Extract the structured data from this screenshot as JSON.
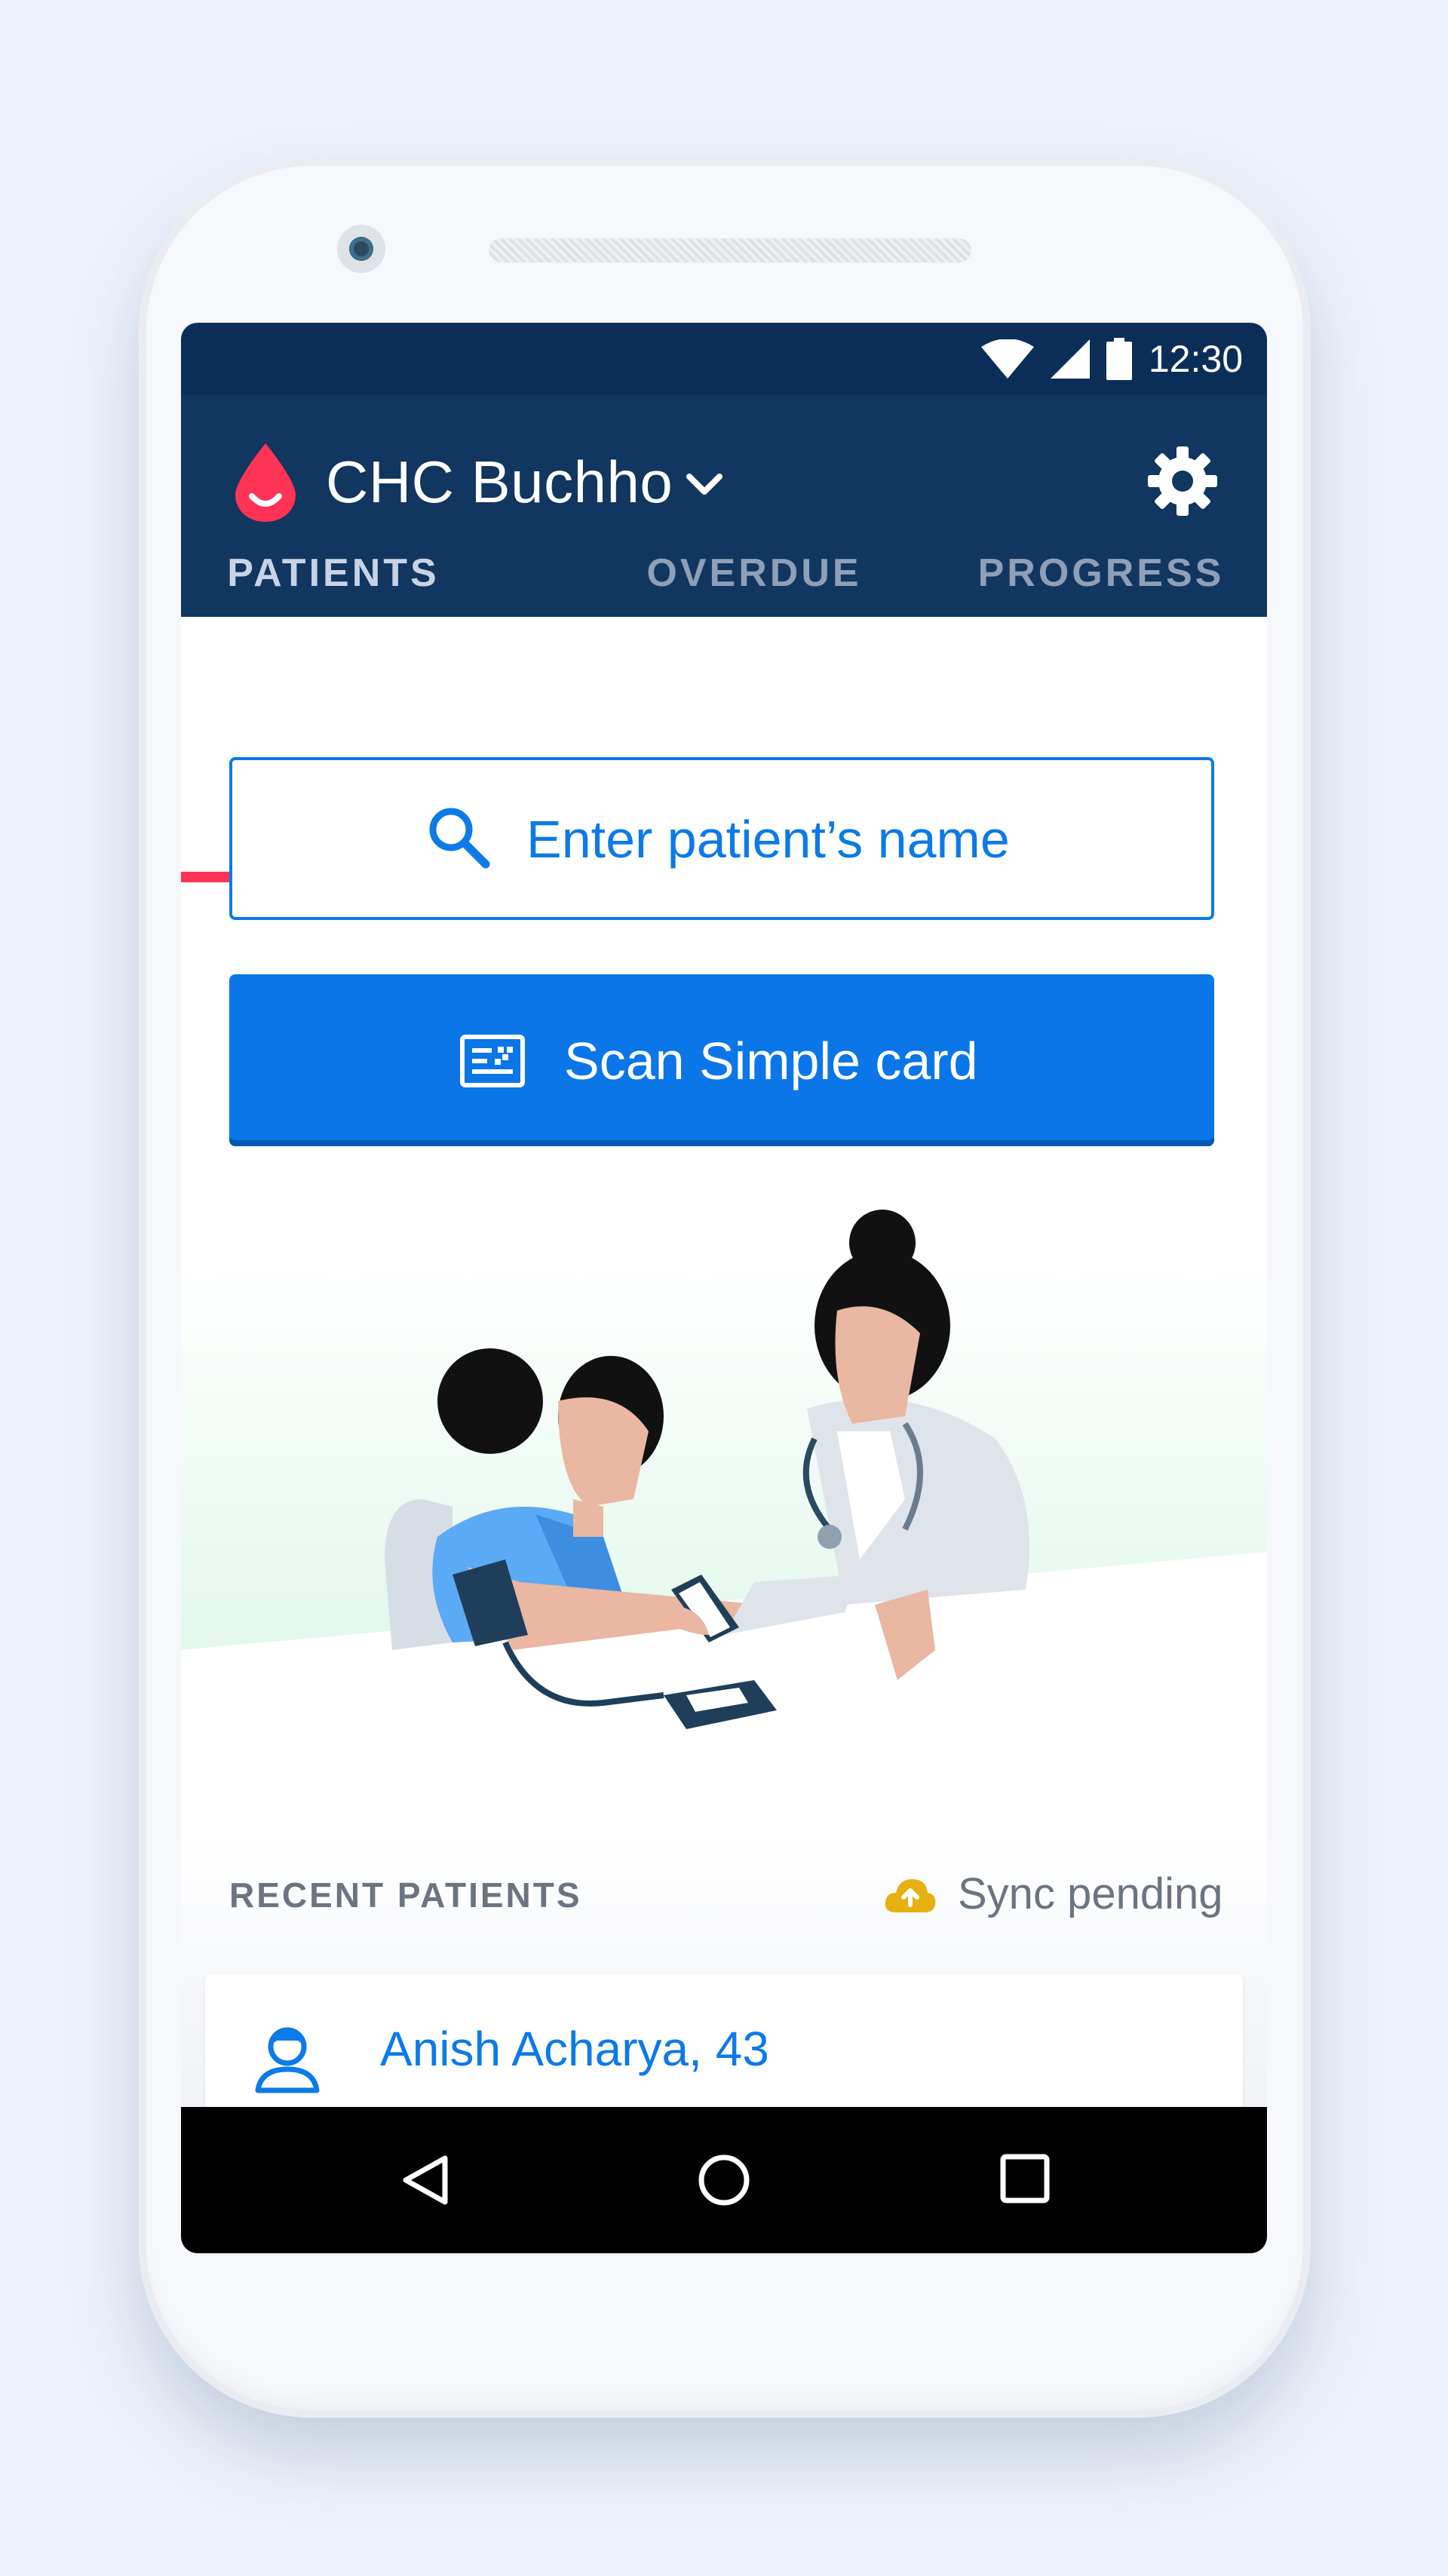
{
  "status_bar": {
    "time": "12:30"
  },
  "app_bar": {
    "facility_name": "CHC Buchho",
    "tabs": [
      {
        "label": "PATIENTS",
        "active": true
      },
      {
        "label": "OVERDUE",
        "active": false
      },
      {
        "label": "PROGRESS",
        "active": false
      }
    ]
  },
  "search": {
    "placeholder": "Enter patient’s name"
  },
  "scan_button": {
    "label": "Scan Simple card"
  },
  "recent": {
    "header": "RECENT PATIENTS",
    "sync_status": "Sync pending",
    "patients": [
      {
        "label": "Anish Acharya, 43"
      }
    ]
  },
  "colors": {
    "primary_dark": "#11365f",
    "status_bar": "#0b2e59",
    "accent_red": "#ff3355",
    "primary_blue": "#0a76e8",
    "sync_yellow": "#e6b010"
  },
  "icons": [
    "blood-drop-icon",
    "chevron-down-icon",
    "gear-icon",
    "search-icon",
    "scan-card-icon",
    "cloud-upload-icon",
    "person-icon",
    "back-icon",
    "home-icon",
    "recents-icon",
    "wifi-icon",
    "signal-icon",
    "battery-icon"
  ]
}
